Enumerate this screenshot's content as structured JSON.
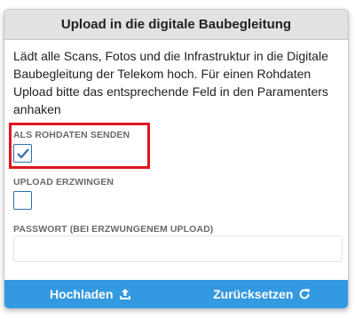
{
  "dialog": {
    "title": "Upload in die digitale Baubegleitung",
    "description": "Lädt alle Scans, Fotos und die Infrastruktur in die Digitale Baubegleitung der Telekom hoch. Für einen Rohdaten Upload bitte das entsprechende Feld in den Paramenters anhaken"
  },
  "fields": {
    "raw_data": {
      "label": "ALS ROHDATEN SENDEN",
      "checked": true
    },
    "force_upload": {
      "label": "UPLOAD ERZWINGEN",
      "checked": false
    },
    "password": {
      "label": "PASSWORT (BEI ERZWUNGENEM UPLOAD)",
      "value": "",
      "placeholder": ""
    }
  },
  "footer": {
    "upload_label": "Hochladen",
    "upload_icon": "upload-icon",
    "reset_label": "Zurücksetzen",
    "reset_icon": "refresh-icon"
  },
  "colors": {
    "header_bg": "#e2e2e2",
    "footer_bg": "#3399e0",
    "checkbox_border": "#2a6fb5",
    "highlight": "#e0161e"
  }
}
